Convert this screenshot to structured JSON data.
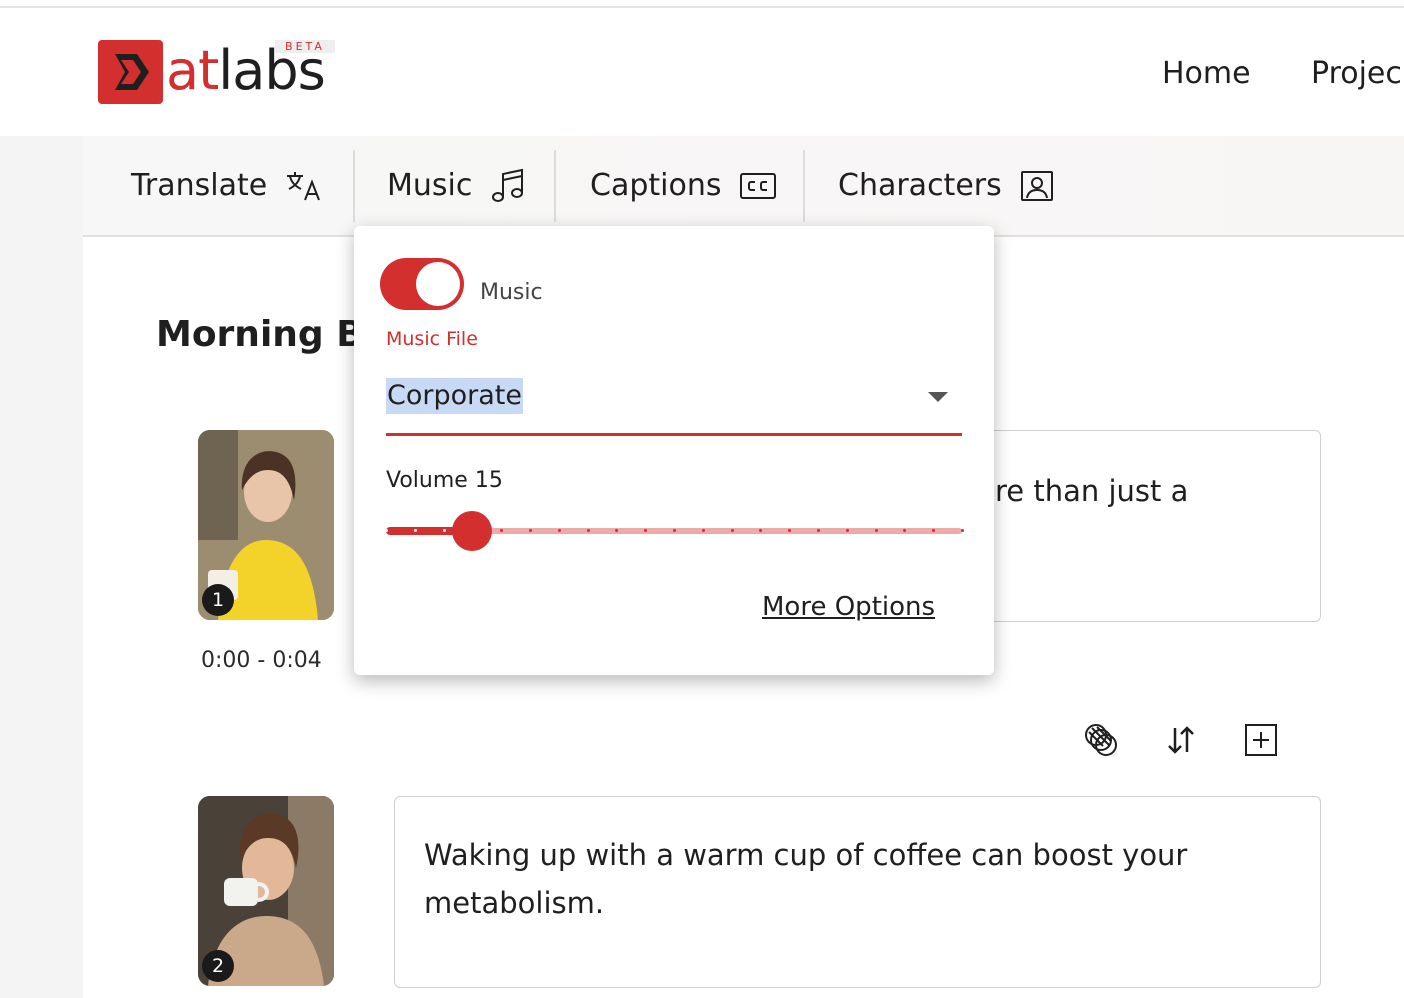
{
  "brand": {
    "logo_at": "at",
    "logo_labs": "labs",
    "beta_label": "BETA",
    "accent": "#d32f2f"
  },
  "nav": {
    "home": "Home",
    "projects": "Projec"
  },
  "toolbar": {
    "tabs": [
      {
        "label": "Translate",
        "icon": "translate-icon"
      },
      {
        "label": "Music",
        "icon": "music-note-icon"
      },
      {
        "label": "Captions",
        "icon": "closed-captions-icon"
      },
      {
        "label": "Characters",
        "icon": "portrait-icon"
      }
    ]
  },
  "page": {
    "title": "Morning Br"
  },
  "scenes": [
    {
      "number": "1",
      "time": "0:00 - 0:04",
      "text": "re than just a"
    },
    {
      "number": "2",
      "text": "Waking up with a warm cup of coffee can boost your metabolism."
    }
  ],
  "music_panel": {
    "toggle_label": "Music",
    "toggle_on": true,
    "file_label": "Music File",
    "file_value": "Corporate",
    "volume_label": "Volume 15",
    "volume": 15,
    "volume_max": 100,
    "more_options": "More Options"
  }
}
